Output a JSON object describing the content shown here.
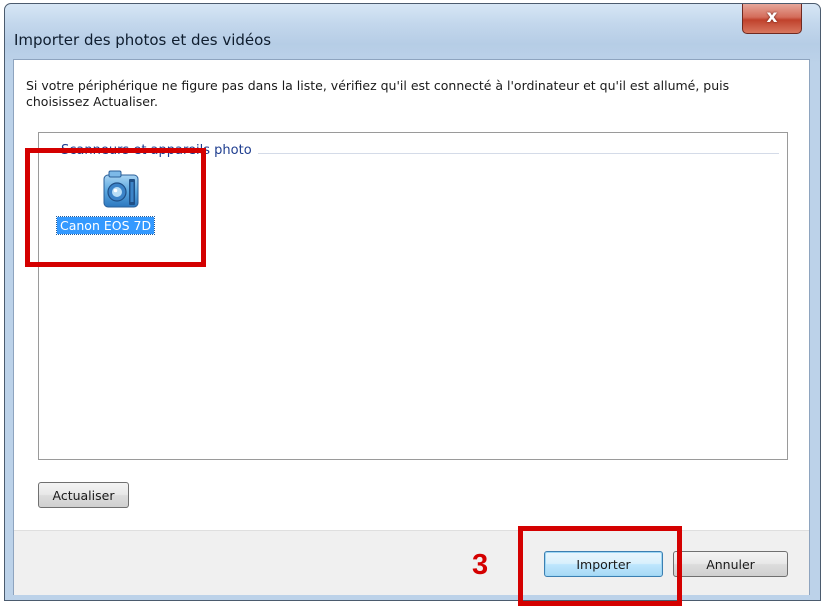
{
  "window": {
    "title": "Importer des photos et des vidéos",
    "close_label": "x"
  },
  "content": {
    "description": "Si votre périphérique ne figure pas dans la liste, vérifiez qu'il est connecté à l'ordinateur et qu'il est allumé, puis choisissez Actualiser.",
    "group_header": "Scanneurs et appareils photo",
    "devices": [
      {
        "label": "Canon EOS 7D",
        "icon": "camera-icon",
        "selected": true
      }
    ]
  },
  "buttons": {
    "refresh": "Actualiser",
    "import": "Importer",
    "cancel": "Annuler"
  },
  "annotation": {
    "step_number": "3",
    "color": "#d40000"
  },
  "colors": {
    "selection": "#3399ff",
    "group_header": "#1e3d8f",
    "close_button": "#c0412c"
  }
}
